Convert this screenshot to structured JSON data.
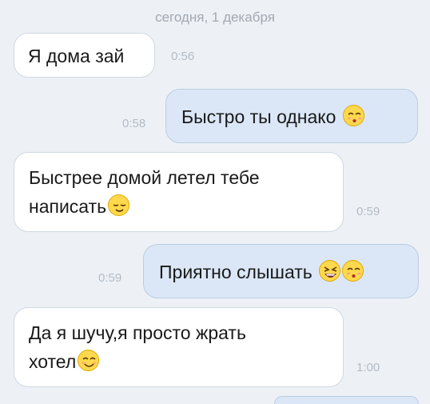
{
  "chat": {
    "date_divider": "сегодня, 1 декабря",
    "messages": [
      {
        "direction": "incoming",
        "text": "Я дома зай",
        "time": "0:56",
        "emojis": []
      },
      {
        "direction": "outgoing",
        "text": "Быстро ты однако",
        "time": "0:58",
        "emojis": [
          "kissing-closed-eyes-emoji"
        ]
      },
      {
        "direction": "incoming",
        "text_line1": "Быстрее домой летел тебе",
        "text_line2": "написать",
        "time": "0:59",
        "emojis": [
          "relieved-face-emoji"
        ]
      },
      {
        "direction": "outgoing",
        "text": "Приятно слышать",
        "time": "0:59",
        "emojis": [
          "laughing-face-emoji",
          "kissing-closed-eyes-emoji"
        ]
      },
      {
        "direction": "incoming",
        "text_line1": "Да я шучу,я просто жрать",
        "text_line2": "хотел",
        "time": "1:00",
        "emojis": [
          "smiling-face-emoji"
        ]
      }
    ]
  },
  "colors": {
    "background": "#edf1f6",
    "incoming_bubble": "#ffffff",
    "outgoing_bubble": "#dbe7f6",
    "timestamp": "#b3bbc5",
    "emoji_yellow": "#ffd84d"
  }
}
